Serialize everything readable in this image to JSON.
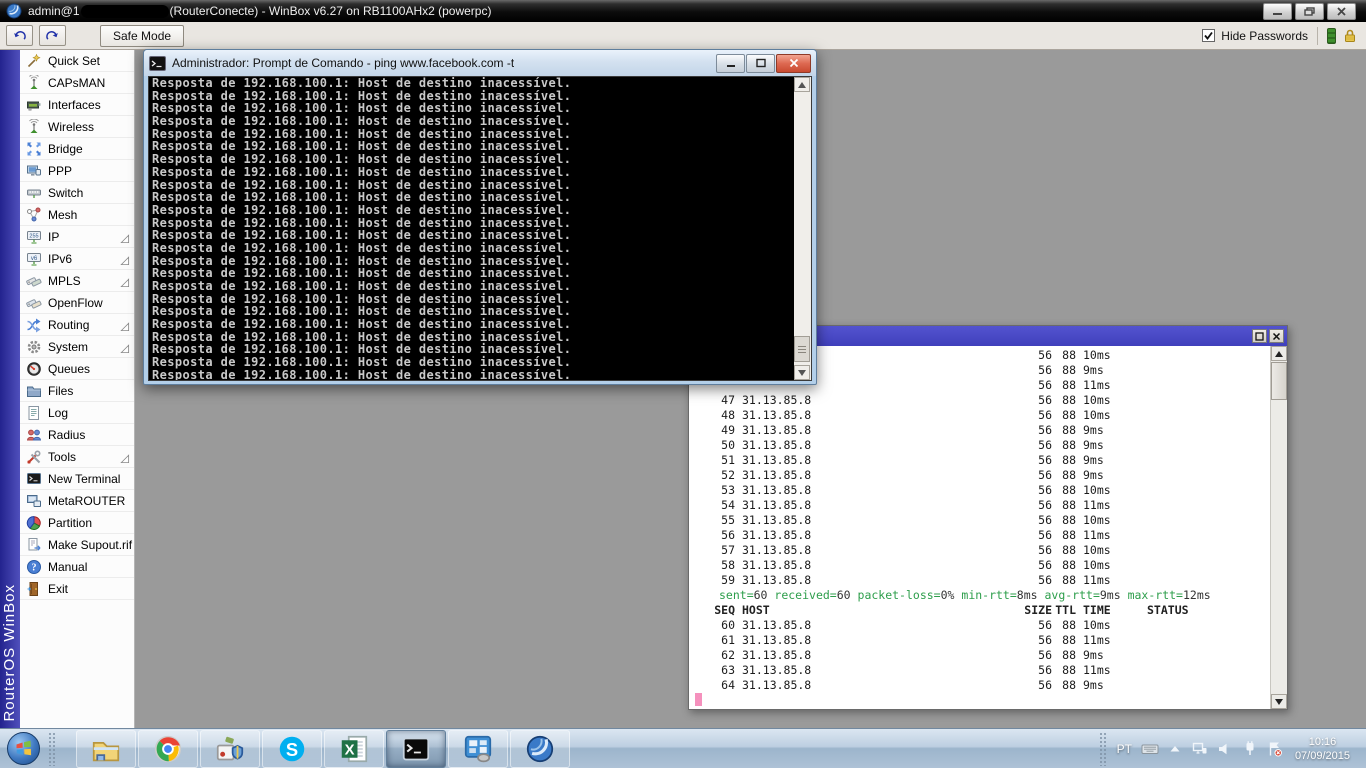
{
  "titlebar": {
    "title_prefix": "admin@1",
    "title_suffix": "(RouterConecte) - WinBox v6.27 on RB1100AHx2 (powerpc)"
  },
  "toolbar": {
    "safe_mode_label": "Safe Mode",
    "hide_passwords_label": "Hide Passwords",
    "hide_passwords_checked": true
  },
  "brand": {
    "vertical_text": "RouterOS WinBox"
  },
  "sidebar": {
    "items": [
      {
        "label": "Quick Set",
        "icon": "quickset-icon",
        "arrow": false
      },
      {
        "label": "CAPsMAN",
        "icon": "capsman-icon",
        "arrow": false
      },
      {
        "label": "Interfaces",
        "icon": "interfaces-icon",
        "arrow": false
      },
      {
        "label": "Wireless",
        "icon": "wireless-icon",
        "arrow": false
      },
      {
        "label": "Bridge",
        "icon": "bridge-icon",
        "arrow": false
      },
      {
        "label": "PPP",
        "icon": "ppp-icon",
        "arrow": false
      },
      {
        "label": "Switch",
        "icon": "switch-icon",
        "arrow": false
      },
      {
        "label": "Mesh",
        "icon": "mesh-icon",
        "arrow": false
      },
      {
        "label": "IP",
        "icon": "ip-icon",
        "arrow": true
      },
      {
        "label": "IPv6",
        "icon": "ipv6-icon",
        "arrow": true
      },
      {
        "label": "MPLS",
        "icon": "mpls-icon",
        "arrow": true
      },
      {
        "label": "OpenFlow",
        "icon": "openflow-icon",
        "arrow": false
      },
      {
        "label": "Routing",
        "icon": "routing-icon",
        "arrow": true
      },
      {
        "label": "System",
        "icon": "system-icon",
        "arrow": true
      },
      {
        "label": "Queues",
        "icon": "queues-icon",
        "arrow": false
      },
      {
        "label": "Files",
        "icon": "files-icon",
        "arrow": false
      },
      {
        "label": "Log",
        "icon": "log-icon",
        "arrow": false
      },
      {
        "label": "Radius",
        "icon": "radius-icon",
        "arrow": false
      },
      {
        "label": "Tools",
        "icon": "tools-icon",
        "arrow": true
      },
      {
        "label": "New Terminal",
        "icon": "terminal-icon",
        "arrow": false
      },
      {
        "label": "MetaROUTER",
        "icon": "metarouter-icon",
        "arrow": false
      },
      {
        "label": "Partition",
        "icon": "partition-icon",
        "arrow": false
      },
      {
        "label": "Make Supout.rif",
        "icon": "supout-icon",
        "arrow": false
      },
      {
        "label": "Manual",
        "icon": "manual-icon",
        "arrow": false
      },
      {
        "label": "Exit",
        "icon": "exit-icon",
        "arrow": false
      }
    ]
  },
  "cmd_window": {
    "title": "Administrador: Prompt de Comando - ping  www.facebook.com -t",
    "output_line": "Resposta de 192.168.100.1: Host de destino inacessível.",
    "repeat": 24
  },
  "terminal": {
    "lines": [
      {
        "type": "row",
        "seq": "",
        "host": "",
        "size": "56",
        "ttl": "88",
        "time": "10ms",
        "status": ""
      },
      {
        "type": "row",
        "seq": "",
        "host": "",
        "size": "56",
        "ttl": "88",
        "time": "9ms",
        "status": ""
      },
      {
        "type": "row",
        "seq": "",
        "host": "",
        "size": "56",
        "ttl": "88",
        "time": "11ms",
        "status": ""
      },
      {
        "type": "row",
        "seq": "47",
        "host": "31.13.85.8",
        "size": "56",
        "ttl": "88",
        "time": "10ms",
        "status": ""
      },
      {
        "type": "row",
        "seq": "48",
        "host": "31.13.85.8",
        "size": "56",
        "ttl": "88",
        "time": "10ms",
        "status": ""
      },
      {
        "type": "row",
        "seq": "49",
        "host": "31.13.85.8",
        "size": "56",
        "ttl": "88",
        "time": "9ms",
        "status": ""
      },
      {
        "type": "row",
        "seq": "50",
        "host": "31.13.85.8",
        "size": "56",
        "ttl": "88",
        "time": "9ms",
        "status": ""
      },
      {
        "type": "row",
        "seq": "51",
        "host": "31.13.85.8",
        "size": "56",
        "ttl": "88",
        "time": "9ms",
        "status": ""
      },
      {
        "type": "row",
        "seq": "52",
        "host": "31.13.85.8",
        "size": "56",
        "ttl": "88",
        "time": "9ms",
        "status": ""
      },
      {
        "type": "row",
        "seq": "53",
        "host": "31.13.85.8",
        "size": "56",
        "ttl": "88",
        "time": "10ms",
        "status": ""
      },
      {
        "type": "row",
        "seq": "54",
        "host": "31.13.85.8",
        "size": "56",
        "ttl": "88",
        "time": "11ms",
        "status": ""
      },
      {
        "type": "row",
        "seq": "55",
        "host": "31.13.85.8",
        "size": "56",
        "ttl": "88",
        "time": "10ms",
        "status": ""
      },
      {
        "type": "row",
        "seq": "56",
        "host": "31.13.85.8",
        "size": "56",
        "ttl": "88",
        "time": "11ms",
        "status": ""
      },
      {
        "type": "row",
        "seq": "57",
        "host": "31.13.85.8",
        "size": "56",
        "ttl": "88",
        "time": "10ms",
        "status": ""
      },
      {
        "type": "row",
        "seq": "58",
        "host": "31.13.85.8",
        "size": "56",
        "ttl": "88",
        "time": "10ms",
        "status": ""
      },
      {
        "type": "row",
        "seq": "59",
        "host": "31.13.85.8",
        "size": "56",
        "ttl": "88",
        "time": "11ms",
        "status": ""
      },
      {
        "type": "summary",
        "pairs": [
          {
            "k": "sent",
            "v": "60"
          },
          {
            "k": "received",
            "v": "60"
          },
          {
            "k": "packet-loss",
            "v": "0%"
          },
          {
            "k": "min-rtt",
            "v": "8ms"
          },
          {
            "k": "avg-rtt",
            "v": "9ms"
          },
          {
            "k": "max-rtt",
            "v": "12ms"
          }
        ]
      },
      {
        "type": "header",
        "seq": "SEQ",
        "host": "HOST",
        "size": "SIZE",
        "ttl": "TTL",
        "time": "TIME",
        "status": "STATUS"
      },
      {
        "type": "row",
        "seq": "60",
        "host": "31.13.85.8",
        "size": "56",
        "ttl": "88",
        "time": "10ms",
        "status": ""
      },
      {
        "type": "row",
        "seq": "61",
        "host": "31.13.85.8",
        "size": "56",
        "ttl": "88",
        "time": "11ms",
        "status": ""
      },
      {
        "type": "row",
        "seq": "62",
        "host": "31.13.85.8",
        "size": "56",
        "ttl": "88",
        "time": "9ms",
        "status": ""
      },
      {
        "type": "row",
        "seq": "63",
        "host": "31.13.85.8",
        "size": "56",
        "ttl": "88",
        "time": "11ms",
        "status": ""
      },
      {
        "type": "row",
        "seq": "64",
        "host": "31.13.85.8",
        "size": "56",
        "ttl": "88",
        "time": "9ms",
        "status": ""
      },
      {
        "type": "cursor"
      }
    ]
  },
  "taskbar": {
    "apps": [
      {
        "app": "explorer",
        "icon": "explorer-icon",
        "active": false
      },
      {
        "app": "chrome",
        "icon": "chrome-icon",
        "active": false
      },
      {
        "app": "router-utility",
        "icon": "router-utility-icon",
        "active": false
      },
      {
        "app": "skype",
        "icon": "skype-icon",
        "active": false
      },
      {
        "app": "excel",
        "icon": "excel-icon",
        "active": false
      },
      {
        "app": "command-prompt",
        "icon": "cmd-icon",
        "active": true
      },
      {
        "app": "network-places",
        "icon": "network-places-icon",
        "active": false
      },
      {
        "app": "winbox",
        "icon": "winbox-sphere-icon",
        "active": false
      }
    ],
    "tray": {
      "language": "PT",
      "icons": [
        "keyboard",
        "hidden-icons",
        "network",
        "volume",
        "power",
        "action-center"
      ],
      "time": "10:16",
      "date": "07/09/2015"
    }
  }
}
